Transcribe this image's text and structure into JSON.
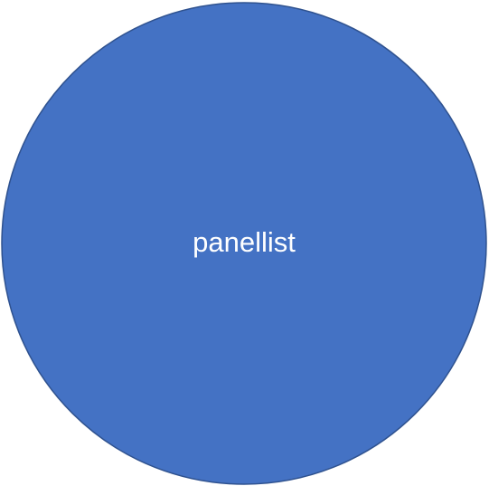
{
  "diagram": {
    "nodes": [
      {
        "label": "panellist",
        "fill": "#4472C4",
        "stroke": "#2F528F",
        "text_color": "#FFFFFF"
      }
    ]
  }
}
